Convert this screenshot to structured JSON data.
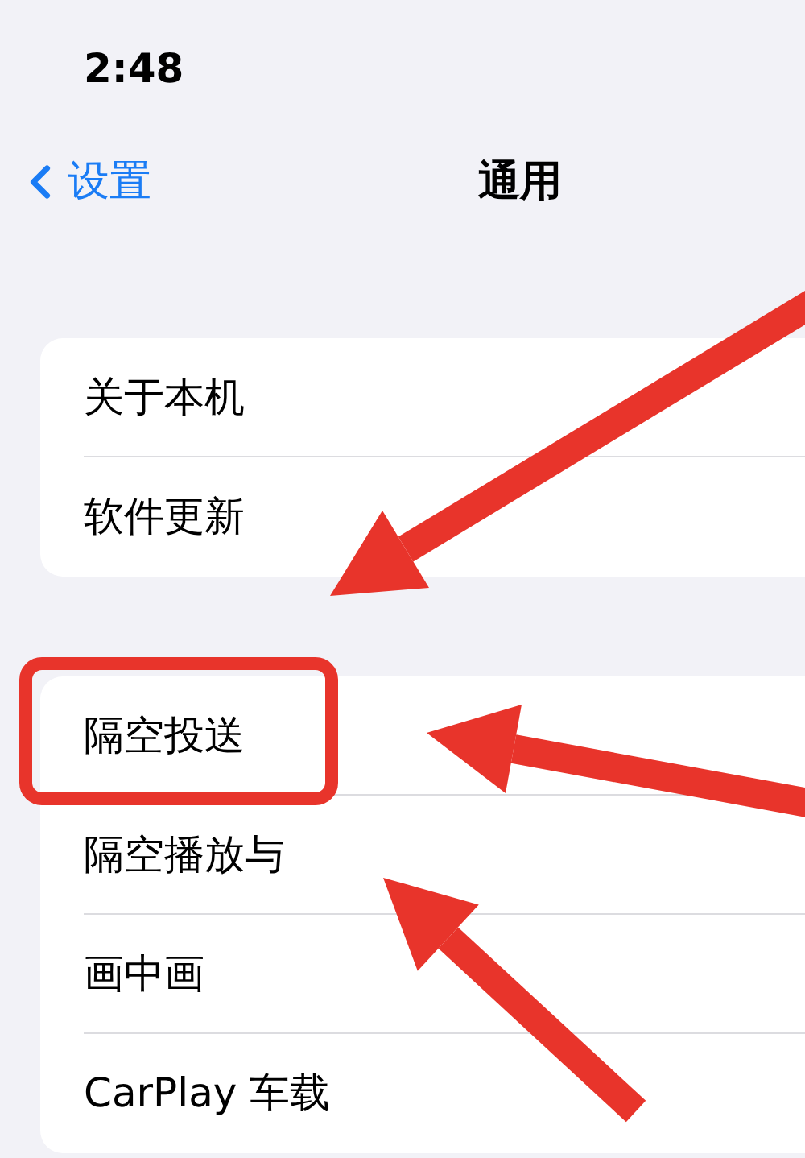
{
  "status_bar": {
    "time": "2:48"
  },
  "nav": {
    "back_label": "设置",
    "title": "通用"
  },
  "groups": [
    {
      "items": [
        {
          "label": "关于本机",
          "highlighted": false
        },
        {
          "label": "软件更新",
          "highlighted": false
        }
      ]
    },
    {
      "items": [
        {
          "label": "隔空投送",
          "highlighted": true
        },
        {
          "label": "隔空播放与",
          "highlighted": false
        },
        {
          "label": "画中画",
          "highlighted": false
        },
        {
          "label": "CarPlay 车载",
          "highlighted": false
        }
      ]
    }
  ]
}
